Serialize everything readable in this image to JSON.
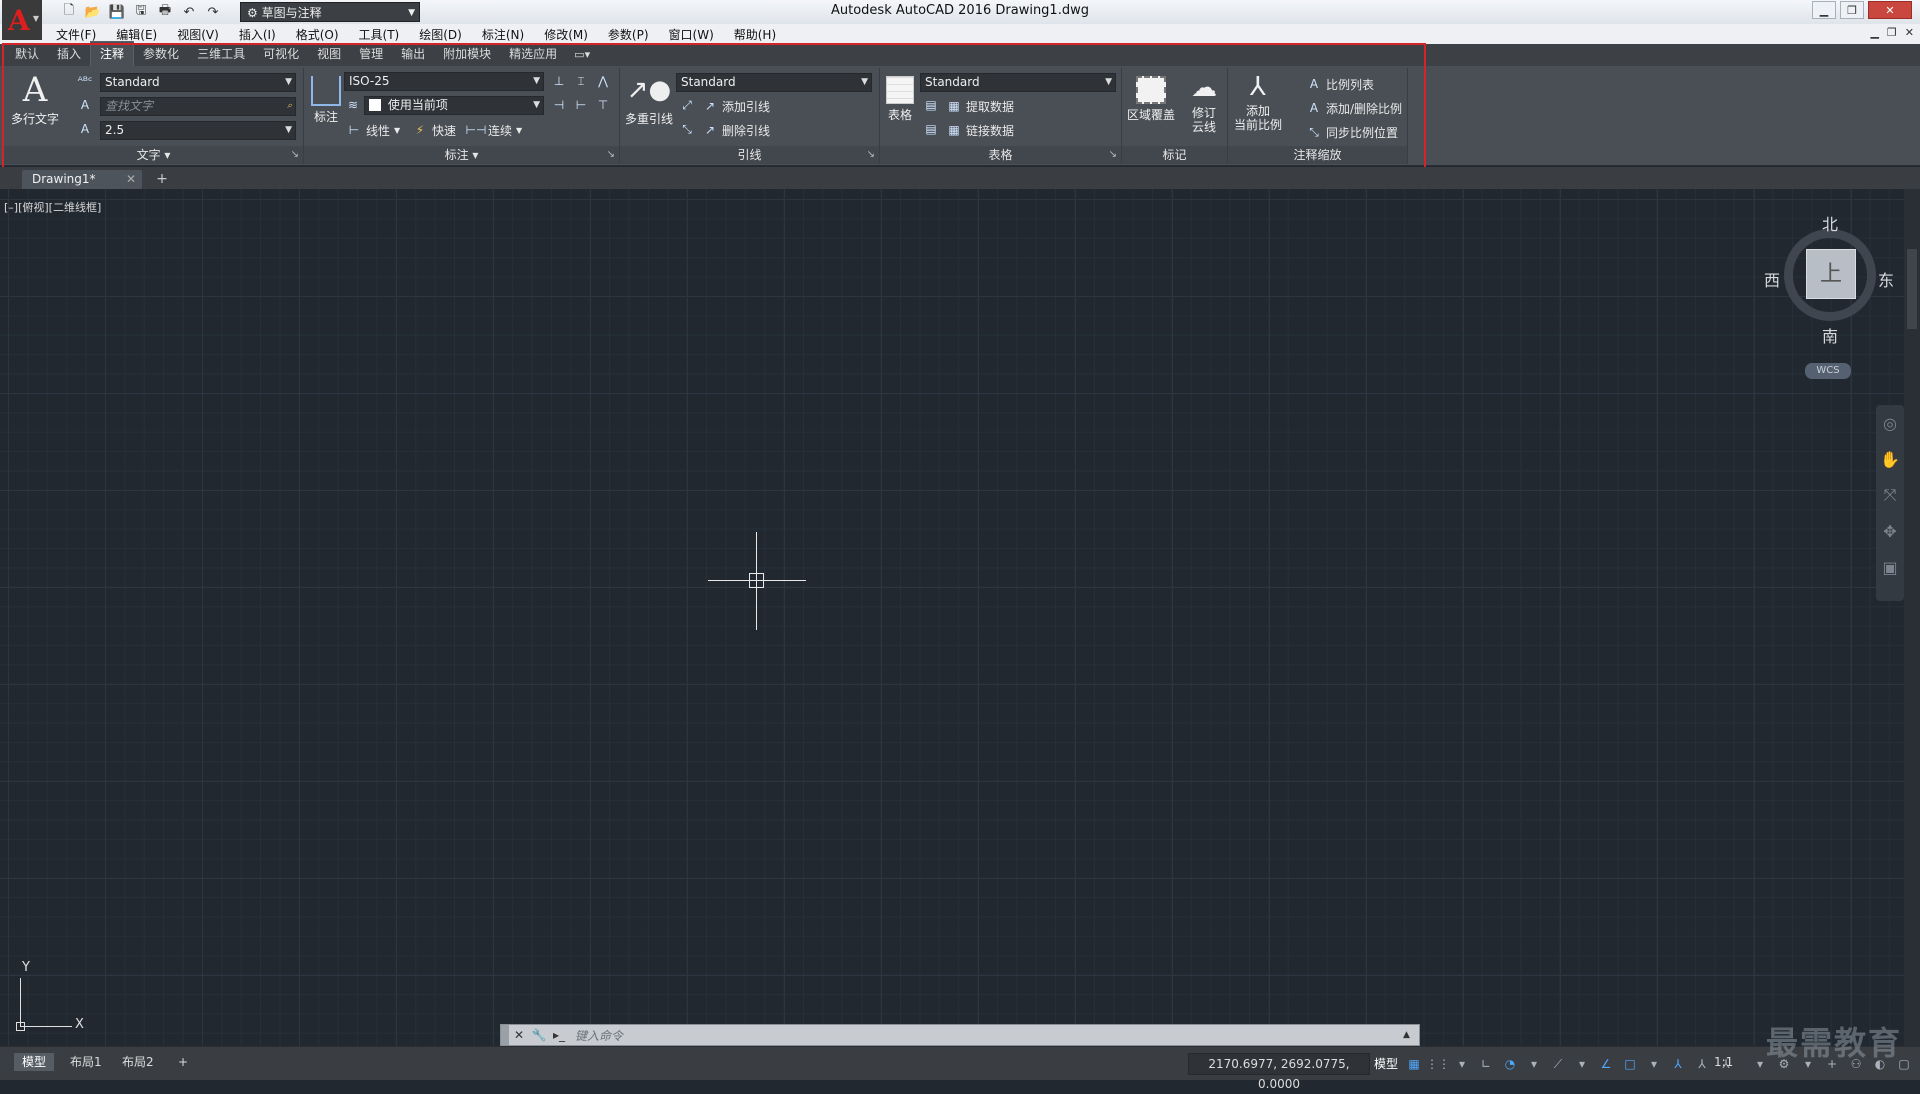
{
  "app": {
    "title": "Autodesk AutoCAD 2016    Drawing1.dwg",
    "workspace": "草图与注释"
  },
  "menu": [
    "文件(F)",
    "编辑(E)",
    "视图(V)",
    "插入(I)",
    "格式(O)",
    "工具(T)",
    "绘图(D)",
    "标注(N)",
    "修改(M)",
    "参数(P)",
    "窗口(W)",
    "帮助(H)"
  ],
  "ribbon_tabs": [
    "默认",
    "插入",
    "注释",
    "参数化",
    "三维工具",
    "可视化",
    "视图",
    "管理",
    "输出",
    "附加模块",
    "精选应用"
  ],
  "text_panel": {
    "multiline_text": "多行文字",
    "style": "Standard",
    "find_placeholder": "查找文字",
    "height": "2.5",
    "footer": "文字"
  },
  "dimension_panel": {
    "dimension_btn": "标注",
    "dim_style": "ISO-25",
    "layer": "使用当前项",
    "linear": "线性",
    "quick": "快速",
    "continue": "连续",
    "footer": "标注"
  },
  "leader_panel": {
    "multileader": "多重引线",
    "style": "Standard",
    "add_leader": "添加引线",
    "remove_leader": "删除引线",
    "footer": "引线"
  },
  "table_panel": {
    "table_btn": "表格",
    "style": "Standard",
    "extract_data": "提取数据",
    "link_data": "链接数据",
    "footer": "表格"
  },
  "markup_panel": {
    "wipeout": "区域覆盖",
    "revcloud_line1": "修订",
    "revcloud_line2": "云线",
    "footer": "标记"
  },
  "scaling_panel": {
    "add_line1": "添加",
    "add_line2": "当前比例",
    "scale_list": "比例列表",
    "add_delete_scales": "添加/删除比例",
    "sync_positions": "同步比例位置",
    "footer": "注释缩放"
  },
  "doc_tab": "Drawing1*",
  "viewport_label": "[–][俯视][二维线框]",
  "viewcube": {
    "north": "北",
    "south": "南",
    "east": "东",
    "west": "西",
    "face": "上",
    "wcs": "WCS"
  },
  "ucs": {
    "x": "X",
    "y": "Y"
  },
  "command_line": {
    "placeholder": "键入命令"
  },
  "layouts": [
    "模型",
    "布局1",
    "布局2"
  ],
  "status": {
    "coords": "2170.6977, 2692.0775, 0.0000",
    "model": "模型",
    "scale": "1:1"
  },
  "watermark": "最需教育",
  "colors": {
    "highlight_box": "#d4242a",
    "canvas": "#212830",
    "accent": "#4ea8ff"
  }
}
